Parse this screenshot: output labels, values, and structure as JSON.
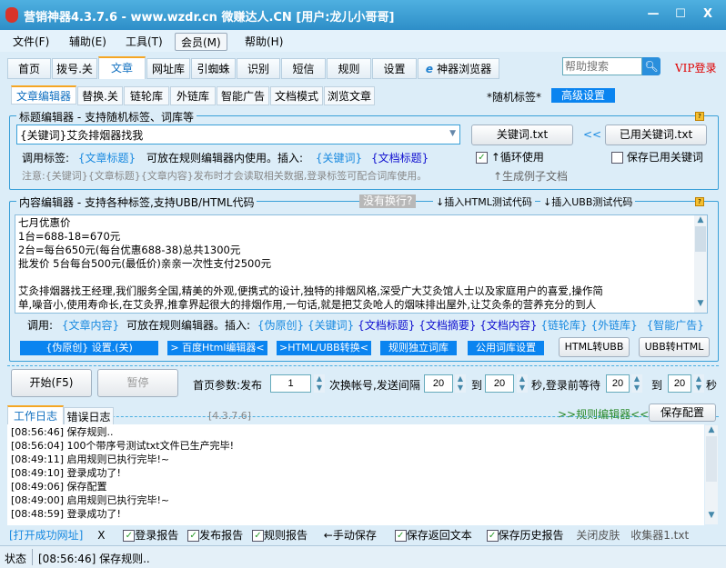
{
  "window": {
    "title": "营销神器4.3.7.6 - www.wzdr.cn 微赚达人.CN [用户:龙儿小哥哥]",
    "min": "—",
    "max": "☐",
    "close": "X"
  },
  "menu": [
    "文件(F)",
    "辅助(E)",
    "工具(T)",
    "会员(M)",
    "帮助(H)"
  ],
  "tabs": [
    "首页",
    "拨号.关",
    "文章",
    "网址库",
    "引蜘蛛",
    "识别",
    "短信",
    "规则",
    "设置",
    "神器浏览器"
  ],
  "search": {
    "placeholder": "帮助搜索"
  },
  "vip_login": "VIP登录",
  "subtabs": [
    "文章编辑器",
    "替换.关",
    "链轮库",
    "外链库",
    "智能广告",
    "文档模式",
    "浏览文章"
  ],
  "random_tag": "*随机标签*",
  "advanced": "高级设置",
  "title_editor": {
    "label": "标题编辑器 - 支持随机标签、词库等",
    "value": "{关键词}艾灸排烟器找我",
    "kw_btn": "关键词.txt",
    "arrows": "<<",
    "used_kw_btn": "已用关键词.txt",
    "call_label": "调用标签:",
    "call_tag": "{文章标题}",
    "usable": "可放在规则编辑器内使用。插入:",
    "ins1": "{关键词}",
    "ins2": "{文档标题}",
    "loop": "↑循环使用",
    "save_used": "保存已用关键词",
    "note": "注意:{关键词}{文章标题}{文章内容}发布时才会读取相关数据,登录标签可配合词库使用。",
    "gen": "↑生成例子文档"
  },
  "content_editor": {
    "label": "内容编辑器 - 支持各种标签,支持UBB/HTML代码",
    "no_newline": "没有换行?",
    "ins_html": "↓插入HTML测试代码",
    "ins_ubb": "↓插入UBB测试代码",
    "lines": [
      "七月优惠价",
      "1台=688-18=670元",
      "2台=每台650元(每台优惠688-38)总共1300元",
      "批发价 5台每台500元(最低价)亲亲一次性支付2500元",
      "",
      "艾灸排烟器找王经理,我们服务全国,精美的外观,便携式的设计,独特的排烟风格,深受广大艾灸馆人士以及家庭用户的喜爱,操作简",
      "单,噪音小,使用寿命长,在艾灸界,推拿界起很大的排烟作用,一句话,就是把艾灸呛人的烟味排出屋外,让艾灸条的营养充分的到人"
    ],
    "call": "调用:",
    "call_tag": "{文章内容}",
    "usable": "可放在规则编辑器。插入:",
    "inserts": [
      "{伪原创}",
      "{关键词}",
      "{文档标题}",
      "{文档摘要}",
      "{文档内容}",
      "{链轮库}",
      "{外链库}",
      "{智能广告}"
    ],
    "buttons": [
      "{伪原创} 设置.(关)",
      "> 百度Html编辑器<",
      ">HTML/UBB转换<",
      "规则独立词库",
      "公用词库设置"
    ],
    "html2ubb": "HTML转UBB",
    "ubb2html": "UBB转HTML"
  },
  "controls": {
    "start": "开始(F5)",
    "pause": "暂停",
    "p1": "首页参数:发布",
    "v1": "1",
    "p2": "次换帐号,发送间隔",
    "v2": "20",
    "to": "到",
    "v3": "20",
    "p3": "秒,登录前等待",
    "v4": "20",
    "v5": "20",
    "sec": "秒"
  },
  "log": {
    "tabs": [
      "工作日志",
      "错误日志"
    ],
    "version": "[4.3.7.6]",
    "rule_editor": ">>规则编辑器<<",
    "save_config": "保存配置",
    "entries": [
      "[08:56:46] 保存规则..",
      "[08:56:04] 100个带序号测试txt文件已生产完毕!",
      "[08:49:11] 启用规则已执行完毕!~",
      "[08:49:10] 登录成功了!",
      "[08:49:06] 保存配置",
      "[08:49:00] 启用规则已执行完毕!~",
      "[08:48:59] 登录成功了!"
    ]
  },
  "options": {
    "open_url": "[打开成功网址]",
    "x": "X",
    "login_report": "登录报告",
    "publish_report": "发布报告",
    "rule_report": "规则报告",
    "manual_save": "←手动保存",
    "save_return": "保存返回文本",
    "save_history": "保存历史报告",
    "close_skin": "关闭皮肤",
    "collector": "收集器1.txt"
  },
  "status": {
    "label": "状态",
    "text": "[08:56:46] 保存规则.."
  }
}
